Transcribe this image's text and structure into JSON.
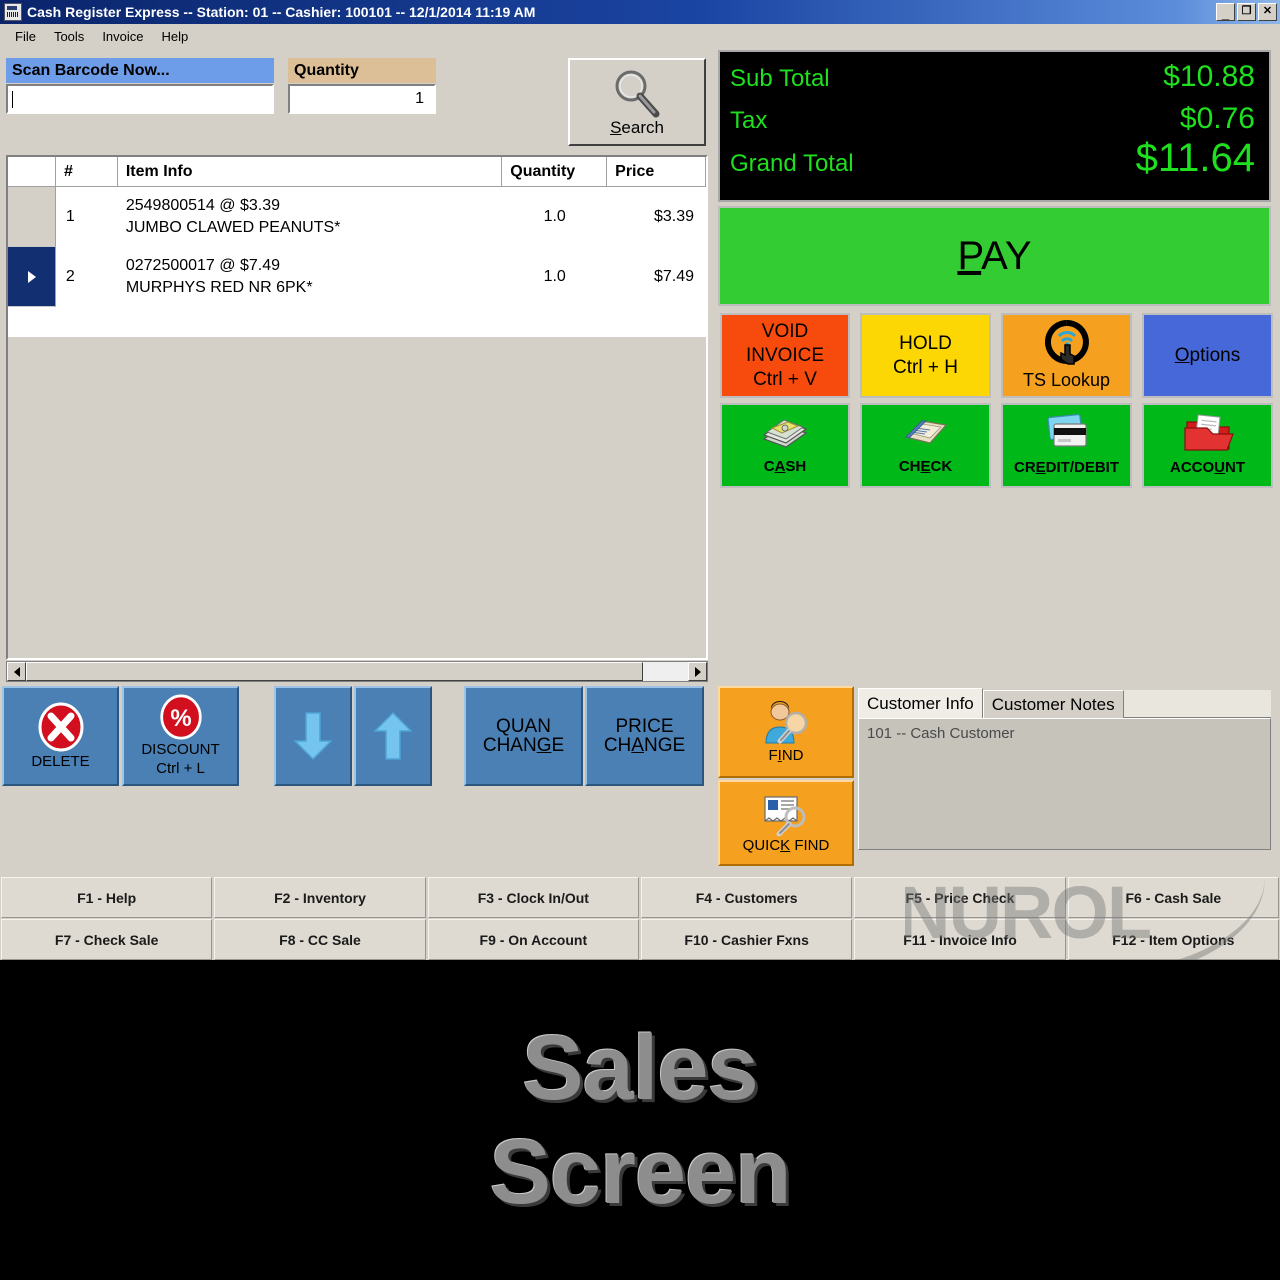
{
  "window": {
    "title": "Cash Register Express -- Station: 01 -- Cashier: 100101 -- 12/1/2014 11:19 AM",
    "minimize": "_",
    "restore": "❐",
    "close": "✕"
  },
  "menu": {
    "items": [
      {
        "label": "File"
      },
      {
        "label": "Tools"
      },
      {
        "label": "Invoice"
      },
      {
        "label": "Help"
      }
    ]
  },
  "entry": {
    "scan_label": "Scan Barcode Now...",
    "scan_value": "",
    "quantity_label": "Quantity",
    "quantity_value": "1",
    "search_label": "Search",
    "search_accel": "S",
    "search_rest": "earch"
  },
  "grid": {
    "columns": [
      "",
      "#",
      "Item Info",
      "Quantity",
      "Price"
    ],
    "rows": [
      {
        "selected": false,
        "num": "1",
        "line1": "2549800514 @  $3.39",
        "line2": "JUMBO CLAWED PEANUTS*",
        "quantity": "1.0",
        "price": "$3.39"
      },
      {
        "selected": true,
        "num": "2",
        "line1": "0272500017 @  $7.49",
        "line2": "MURPHYS RED NR 6PK*",
        "quantity": "1.0",
        "price": "$7.49"
      }
    ]
  },
  "toolbar": {
    "delete_label": "DELETE",
    "discount_label": "DISCOUNT",
    "discount_shortcut": "Ctrl + L",
    "move_down": "down-arrow",
    "move_up": "up-arrow",
    "quan_change_l1": "QUAN",
    "quan_change_l2_pre": "CHAN",
    "quan_change_l2_accel": "G",
    "quan_change_l2_post": "E",
    "price_change_l1": "PRICE",
    "price_change_l2_pre": "CH",
    "price_change_l2_accel": "A",
    "price_change_l2_post": "NGE"
  },
  "totals": {
    "sub_total_label": "Sub Total",
    "sub_total_value": "$10.88",
    "tax_label": "Tax",
    "tax_value": "$0.76",
    "grand_total_label": "Grand Total",
    "grand_total_value": "$11.64",
    "text_color": "#1fe01f",
    "background": "#000000"
  },
  "pay": {
    "accel": "P",
    "rest": "AY",
    "color": "#33cc33"
  },
  "actions": {
    "void_l1": "VOID",
    "void_l2": "INVOICE",
    "void_l3": "Ctrl + V",
    "void_color": "#f64b0c",
    "hold_l1": "HOLD",
    "hold_l2": "Ctrl + H",
    "hold_color": "#fcd703",
    "tslookup_label": "TS Lookup",
    "tslookup_color": "#f5a01e",
    "options_accel": "O",
    "options_rest": "ptions",
    "options_color": "#4668d8",
    "cash_pre": "C",
    "cash_accel": "A",
    "cash_post": "SH",
    "check_pre": "CH",
    "check_accel": "E",
    "check_post": "CK",
    "credit_pre": "CR",
    "credit_accel": "E",
    "credit_post": "DIT/DEBIT",
    "account_pre": "ACCO",
    "account_accel": "U",
    "account_post": "NT",
    "tender_color": "#00b818"
  },
  "customer": {
    "find_pre": "F",
    "find_accel": "I",
    "find_post": "ND",
    "quickfind_pre": "QUIC",
    "quickfind_accel": "K",
    "quickfind_post": " FIND",
    "tabs": [
      {
        "label": "Customer Info",
        "active": true
      },
      {
        "label": "Customer Notes",
        "active": false
      }
    ],
    "info_text": "101 -- Cash Customer"
  },
  "function_keys": [
    {
      "label": "F1 - Help"
    },
    {
      "label": "F2 - Inventory"
    },
    {
      "label": "F3 - Clock In/Out"
    },
    {
      "label": "F4 - Customers"
    },
    {
      "label": "F5 - Price Check"
    },
    {
      "label": "F6 - Cash Sale"
    },
    {
      "label": "F7 - Check Sale"
    },
    {
      "label": "F8 - CC Sale"
    },
    {
      "label": "F9 - On Account"
    },
    {
      "label": "F10 - Cashier Fxns"
    },
    {
      "label": "F11 - Invoice Info"
    },
    {
      "label": "F12 - Item Options"
    }
  ],
  "watermark": {
    "text": "NUROL"
  },
  "caption": {
    "line1": "Sales",
    "line2": "Screen"
  }
}
